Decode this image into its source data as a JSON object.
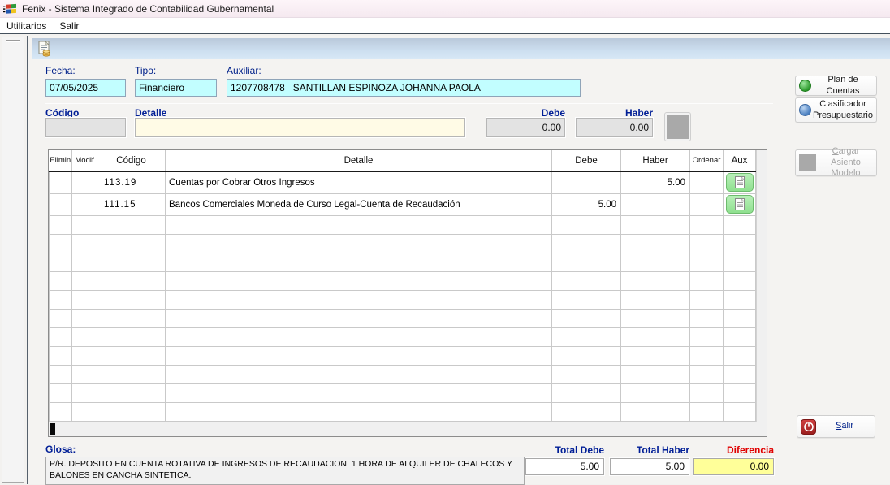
{
  "window": {
    "title": "Fenix - Sistema Integrado de Contabilidad Gubernamental",
    "menu_items": [
      "Utilitarios",
      "Salir"
    ]
  },
  "toolbar": {
    "new_entry_icon": "document-coins-icon"
  },
  "header_form": {
    "fecha_label": "Fecha:",
    "fecha_value": "07/05/2025",
    "tipo_label": "Tipo:",
    "tipo_value": "Financiero",
    "auxiliar_label": "Auxiliar:",
    "auxiliar_value": "1207708478   SANTILLAN ESPINOZA JOHANNA PAOLA"
  },
  "entry_row": {
    "codigo_label": "Código",
    "codigo_value": "",
    "detalle_label": "Detalle",
    "detalle_value": "",
    "debe_label": "Debe",
    "debe_value": "0.00",
    "haber_label": "Haber",
    "haber_value": "0.00"
  },
  "table": {
    "headers": [
      "Elimin",
      "Modif",
      "Código",
      "Detalle",
      "Debe",
      "Haber",
      "Ordenar",
      "Aux"
    ],
    "rows": [
      {
        "elimin": "",
        "modif": "",
        "codigo": "113.19",
        "detalle": "Cuentas por Cobrar Otros Ingresos",
        "debe": "",
        "haber": "5.00",
        "ordenar": "",
        "aux_icon": "document-icon"
      },
      {
        "elimin": "",
        "modif": "",
        "codigo": "111.15",
        "detalle": "Bancos Comerciales Moneda de Curso Legal-Cuenta de Recaudación",
        "debe": "5.00",
        "haber": "",
        "ordenar": "",
        "aux_icon": "document-icon"
      }
    ],
    "empty_rows": 11
  },
  "side_panel": {
    "plan_cuentas_label": "Plan de Cuentas",
    "clasificador_label": "Clasificador Presupuestario",
    "cargar_asiento_label": "Cargar Asiento Modelo",
    "salir_label": "Salir"
  },
  "footer": {
    "glosa_label": "Glosa:",
    "glosa_value": "P/R. DEPOSITO EN CUENTA ROTATIVA DE INGRESOS DE RECAUDACION  1 HORA DE ALQUILER DE CHALECOS Y BALONES EN CANCHA SINTETICA.",
    "total_debe_label": "Total Debe",
    "total_debe_value": "5.00",
    "total_haber_label": "Total Haber",
    "total_haber_value": "5.00",
    "diferencia_label": "Diferencia",
    "diferencia_value": "0.00"
  },
  "colors": {
    "field_cyan": "#c2feff",
    "detalle_pale_yellow": "#fffbe6",
    "diferencia_yellow": "#ffff99",
    "label_navy": "#001e96",
    "diferencia_red": "#e00000",
    "aux_green": "#8fe08f",
    "toolbar_blue_top": "#b9c8da",
    "toolbar_blue_bottom": "#d8e8f6",
    "titlebar_pink": "#f8eef4"
  }
}
